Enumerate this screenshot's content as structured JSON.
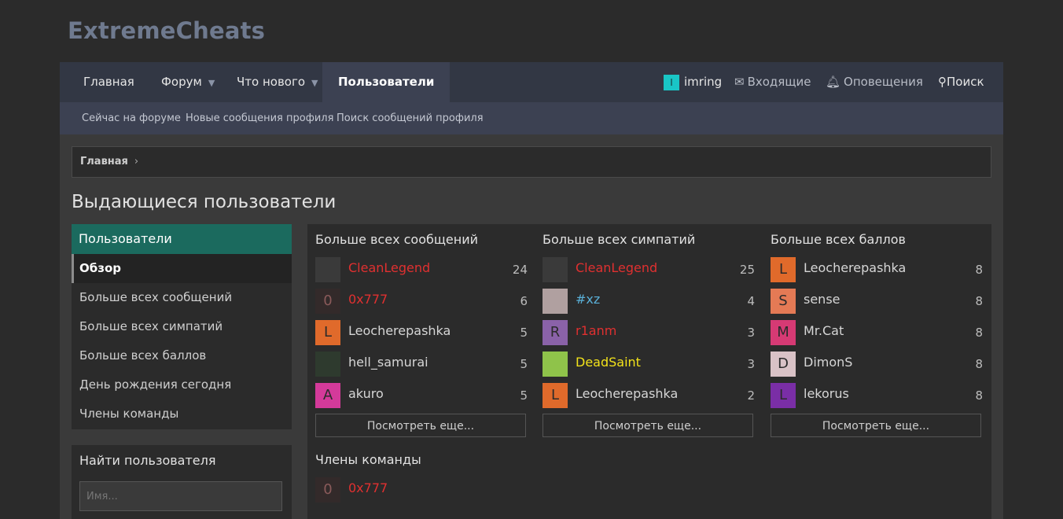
{
  "site": {
    "logo": "ExtremeCheats"
  },
  "nav": {
    "items": [
      {
        "label": "Главная"
      },
      {
        "label": "Форум"
      },
      {
        "label": "Что нового"
      },
      {
        "label": "Пользователи"
      }
    ],
    "user": {
      "avatar_letter": "I",
      "name": "imring"
    },
    "inbox": "Входящие",
    "alerts": "Оповещения",
    "search": "Поиск"
  },
  "subnav": {
    "items": [
      "Сейчас на форуме",
      "Новые сообщения профиля",
      "Поиск сообщений профиля"
    ]
  },
  "breadcrumb": {
    "home": "Главная",
    "sep": "›"
  },
  "page": {
    "title": "Выдающиеся пользователи"
  },
  "sidebar": {
    "header": "Пользователи",
    "items": [
      "Обзор",
      "Больше всех сообщений",
      "Больше всех симпатий",
      "Больше всех баллов",
      "День рождения сегодня",
      "Члены команды"
    ]
  },
  "finder": {
    "title": "Найти пользователя",
    "placeholder": "Имя..."
  },
  "columns": [
    {
      "title": "Больше всех сообщений",
      "rows": [
        {
          "name": "CleanLegend",
          "count": "24",
          "color": "#e03030",
          "letter": "",
          "bg": "#3a3a3a"
        },
        {
          "name": "0x777",
          "count": "6",
          "color": "#e03030",
          "letter": "0",
          "bg": "#332a2a"
        },
        {
          "name": "Leocherepashka",
          "count": "5",
          "color": "#d6d6d6",
          "letter": "L",
          "bg": "#e06a2b"
        },
        {
          "name": "hell_samurai",
          "count": "5",
          "color": "#d6d6d6",
          "letter": "",
          "bg": "#2e3a2e"
        },
        {
          "name": "akuro",
          "count": "5",
          "color": "#d6d6d6",
          "letter": "A",
          "bg": "#d43a9a"
        }
      ],
      "more": "Посмотреть еще..."
    },
    {
      "title": "Больше всех симпатий",
      "rows": [
        {
          "name": "CleanLegend",
          "count": "25",
          "color": "#e03030",
          "letter": "",
          "bg": "#3a3a3a"
        },
        {
          "name": "#xz",
          "count": "4",
          "color": "#5ab0d8",
          "letter": "",
          "bg": "#b0a0a0"
        },
        {
          "name": "r1anm",
          "count": "3",
          "color": "#e03030",
          "letter": "R",
          "bg": "#8a62a8"
        },
        {
          "name": "DeadSaint",
          "count": "3",
          "color": "#f2e21a",
          "letter": "",
          "bg": "#8fc34a"
        },
        {
          "name": "Leocherepashka",
          "count": "2",
          "color": "#d6d6d6",
          "letter": "L",
          "bg": "#e06a2b"
        }
      ],
      "more": "Посмотреть еще..."
    },
    {
      "title": "Больше всех баллов",
      "rows": [
        {
          "name": "Leocherepashka",
          "count": "8",
          "color": "#d6d6d6",
          "letter": "L",
          "bg": "#e06a2b"
        },
        {
          "name": "sense",
          "count": "8",
          "color": "#d6d6d6",
          "letter": "S",
          "bg": "#e47a55"
        },
        {
          "name": "Mr.Cat",
          "count": "8",
          "color": "#d6d6d6",
          "letter": "M",
          "bg": "#d63a74"
        },
        {
          "name": "DimonS",
          "count": "8",
          "color": "#d6d6d6",
          "letter": "D",
          "bg": "#d9c2c6"
        },
        {
          "name": "lekorus",
          "count": "8",
          "color": "#d6d6d6",
          "letter": "L",
          "bg": "#7a2ea6"
        }
      ],
      "more": "Посмотреть еще..."
    }
  ],
  "staff": {
    "title": "Члены команды",
    "rows": [
      {
        "name": "0x777",
        "color": "#e03030",
        "letter": "0",
        "bg": "#332a2a"
      }
    ]
  }
}
